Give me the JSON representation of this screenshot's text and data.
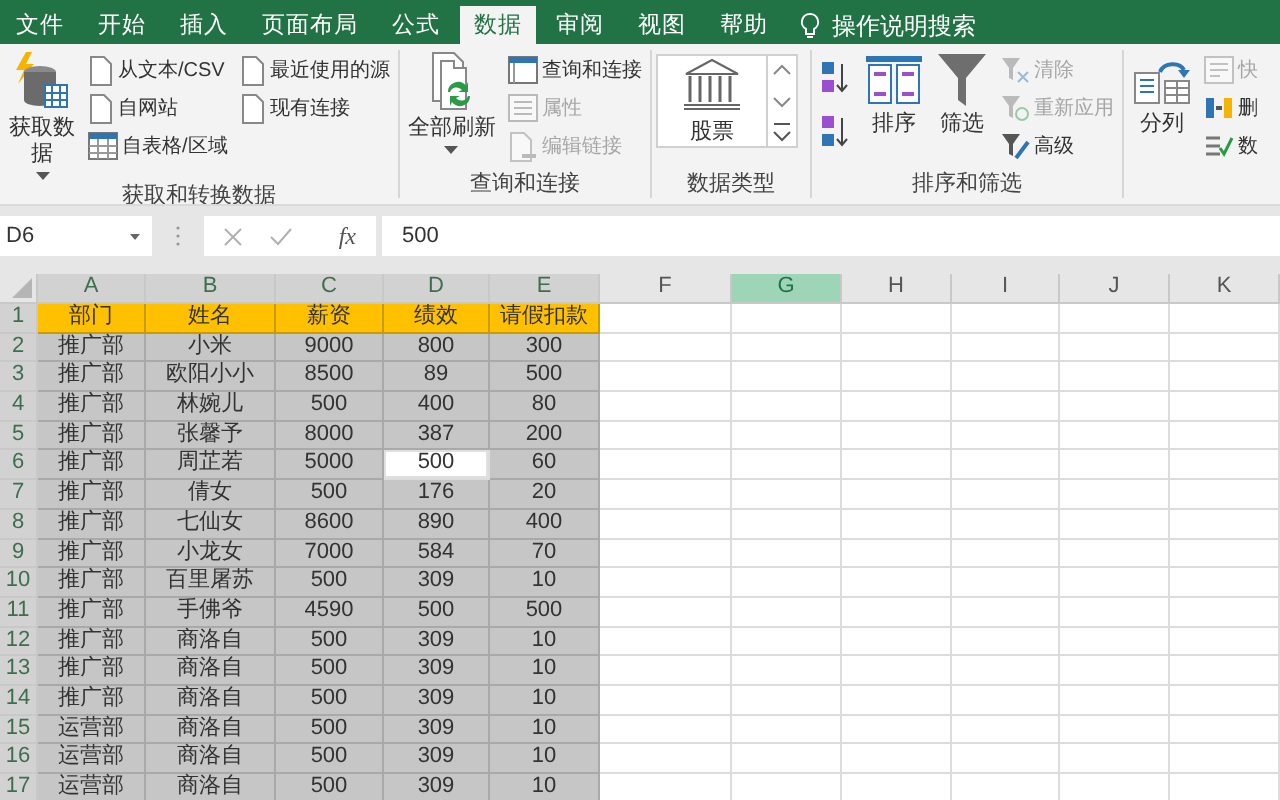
{
  "menu_tabs": [
    {
      "label": "文件",
      "selected": false
    },
    {
      "label": "开始",
      "selected": false
    },
    {
      "label": "插入",
      "selected": false
    },
    {
      "label": "页面布局",
      "selected": false
    },
    {
      "label": "公式",
      "selected": false
    },
    {
      "label": "数据",
      "selected": true
    },
    {
      "label": "审阅",
      "selected": false
    },
    {
      "label": "视图",
      "selected": false
    },
    {
      "label": "帮助",
      "selected": false
    }
  ],
  "tell_me": "操作说明搜索",
  "ribbon": {
    "groups": [
      {
        "label": "获取和转换数据",
        "items": [
          {
            "kind": "large",
            "label": "获取数据",
            "dropdown": true,
            "disabled": false
          },
          {
            "kind": "stack",
            "items": [
              {
                "label": "从文本/CSV",
                "disabled": false
              },
              {
                "label": "自网站",
                "disabled": false
              },
              {
                "label": "自表格/区域",
                "disabled": false
              }
            ]
          },
          {
            "kind": "stack",
            "items": [
              {
                "label": "最近使用的源",
                "disabled": false
              },
              {
                "label": "现有连接",
                "disabled": false
              }
            ]
          }
        ]
      },
      {
        "label": "查询和连接",
        "items": [
          {
            "kind": "large",
            "label": "全部刷新",
            "dropdown": true,
            "disabled": false
          },
          {
            "kind": "stack",
            "items": [
              {
                "label": "查询和连接",
                "disabled": false
              },
              {
                "label": "属性",
                "disabled": true
              },
              {
                "label": "编辑链接",
                "disabled": true
              }
            ]
          }
        ]
      },
      {
        "label": "数据类型",
        "items": [
          {
            "kind": "gallery",
            "label": "股票"
          }
        ]
      },
      {
        "label": "排序和筛选",
        "items": [
          {
            "kind": "stack",
            "items": [
              {
                "disabled": false
              },
              {
                "disabled": false
              }
            ]
          },
          {
            "kind": "large",
            "label": "排序",
            "dropdown": false,
            "disabled": false
          },
          {
            "kind": "large",
            "label": "筛选",
            "dropdown": false,
            "disabled": false
          },
          {
            "kind": "stack",
            "items": [
              {
                "label": "清除",
                "disabled": true
              },
              {
                "label": "重新应用",
                "disabled": true
              },
              {
                "label": "高级",
                "disabled": false
              }
            ]
          }
        ]
      },
      {
        "items": [
          {
            "kind": "large",
            "label": "分列",
            "dropdown": false,
            "disabled": false
          },
          {
            "kind": "stack",
            "items": [
              {
                "label": "快",
                "disabled": true
              },
              {
                "label": "删",
                "disabled": false
              },
              {
                "label": "数",
                "disabled": false
              }
            ]
          }
        ]
      }
    ]
  },
  "formula_bar": {
    "name_box": "D6",
    "fx": "fx",
    "value": "500"
  },
  "sheet": {
    "columns": [
      {
        "letter": "A",
        "selected": true,
        "hovered": false
      },
      {
        "letter": "B",
        "selected": true,
        "hovered": false
      },
      {
        "letter": "C",
        "selected": true,
        "hovered": false
      },
      {
        "letter": "D",
        "selected": true,
        "hovered": false
      },
      {
        "letter": "E",
        "selected": true,
        "hovered": false
      },
      {
        "letter": "F",
        "selected": false,
        "hovered": false
      },
      {
        "letter": "G",
        "selected": false,
        "hovered": true
      },
      {
        "letter": "H",
        "selected": false,
        "hovered": false
      },
      {
        "letter": "I",
        "selected": false,
        "hovered": false
      },
      {
        "letter": "J",
        "selected": false,
        "hovered": false
      },
      {
        "letter": "K",
        "selected": false,
        "hovered": false
      }
    ],
    "rows": [
      {
        "number": "1",
        "kind": "header",
        "selected": true,
        "cells": [
          {
            "text": "部门",
            "active": false
          },
          {
            "text": "姓名",
            "active": false
          },
          {
            "text": "薪资",
            "active": false
          },
          {
            "text": "绩效",
            "active": false
          },
          {
            "text": "请假扣款",
            "active": false
          }
        ]
      },
      {
        "number": "2",
        "kind": "data",
        "selected": true,
        "cells": [
          {
            "text": "推广部",
            "active": false
          },
          {
            "text": "小米",
            "active": false
          },
          {
            "text": "9000",
            "active": false
          },
          {
            "text": "800",
            "active": false
          },
          {
            "text": "300",
            "active": false
          }
        ]
      },
      {
        "number": "3",
        "kind": "data",
        "selected": true,
        "cells": [
          {
            "text": "推广部",
            "active": false
          },
          {
            "text": "欧阳小小",
            "active": false
          },
          {
            "text": "8500",
            "active": false
          },
          {
            "text": "89",
            "active": false
          },
          {
            "text": "500",
            "active": false
          }
        ]
      },
      {
        "number": "4",
        "kind": "data",
        "selected": true,
        "cells": [
          {
            "text": "推广部",
            "active": false
          },
          {
            "text": "林婉儿",
            "active": false
          },
          {
            "text": "500",
            "active": false
          },
          {
            "text": "400",
            "active": false
          },
          {
            "text": "80",
            "active": false
          }
        ]
      },
      {
        "number": "5",
        "kind": "data",
        "selected": true,
        "cells": [
          {
            "text": "推广部",
            "active": false
          },
          {
            "text": "张馨予",
            "active": false
          },
          {
            "text": "8000",
            "active": false
          },
          {
            "text": "387",
            "active": false
          },
          {
            "text": "200",
            "active": false
          }
        ]
      },
      {
        "number": "6",
        "kind": "data",
        "selected": true,
        "cells": [
          {
            "text": "推广部",
            "active": false
          },
          {
            "text": "周芷若",
            "active": false
          },
          {
            "text": "5000",
            "active": false
          },
          {
            "text": "500",
            "active": true
          },
          {
            "text": "60",
            "active": false
          }
        ]
      },
      {
        "number": "7",
        "kind": "data",
        "selected": true,
        "cells": [
          {
            "text": "推广部",
            "active": false
          },
          {
            "text": "倩女",
            "active": false
          },
          {
            "text": "500",
            "active": false
          },
          {
            "text": "176",
            "active": false
          },
          {
            "text": "20",
            "active": false
          }
        ]
      },
      {
        "number": "8",
        "kind": "data",
        "selected": true,
        "cells": [
          {
            "text": "推广部",
            "active": false
          },
          {
            "text": "七仙女",
            "active": false
          },
          {
            "text": "8600",
            "active": false
          },
          {
            "text": "890",
            "active": false
          },
          {
            "text": "400",
            "active": false
          }
        ]
      },
      {
        "number": "9",
        "kind": "data",
        "selected": true,
        "cells": [
          {
            "text": "推广部",
            "active": false
          },
          {
            "text": "小龙女",
            "active": false
          },
          {
            "text": "7000",
            "active": false
          },
          {
            "text": "584",
            "active": false
          },
          {
            "text": "70",
            "active": false
          }
        ]
      },
      {
        "number": "10",
        "kind": "data",
        "selected": true,
        "cells": [
          {
            "text": "推广部",
            "active": false
          },
          {
            "text": "百里屠苏",
            "active": false
          },
          {
            "text": "500",
            "active": false
          },
          {
            "text": "309",
            "active": false
          },
          {
            "text": "10",
            "active": false
          }
        ]
      },
      {
        "number": "11",
        "kind": "data",
        "selected": true,
        "cells": [
          {
            "text": "推广部",
            "active": false
          },
          {
            "text": "手佛爷",
            "active": false
          },
          {
            "text": "4590",
            "active": false
          },
          {
            "text": "500",
            "active": false
          },
          {
            "text": "500",
            "active": false
          }
        ]
      },
      {
        "number": "12",
        "kind": "data",
        "selected": true,
        "cells": [
          {
            "text": "推广部",
            "active": false
          },
          {
            "text": "商洛自",
            "active": false
          },
          {
            "text": "500",
            "active": false
          },
          {
            "text": "309",
            "active": false
          },
          {
            "text": "10",
            "active": false
          }
        ]
      },
      {
        "number": "13",
        "kind": "data",
        "selected": true,
        "cells": [
          {
            "text": "推广部",
            "active": false
          },
          {
            "text": "商洛自",
            "active": false
          },
          {
            "text": "500",
            "active": false
          },
          {
            "text": "309",
            "active": false
          },
          {
            "text": "10",
            "active": false
          }
        ]
      },
      {
        "number": "14",
        "kind": "data",
        "selected": true,
        "cells": [
          {
            "text": "推广部",
            "active": false
          },
          {
            "text": "商洛自",
            "active": false
          },
          {
            "text": "500",
            "active": false
          },
          {
            "text": "309",
            "active": false
          },
          {
            "text": "10",
            "active": false
          }
        ]
      },
      {
        "number": "15",
        "kind": "data",
        "selected": true,
        "cells": [
          {
            "text": "运营部",
            "active": false
          },
          {
            "text": "商洛自",
            "active": false
          },
          {
            "text": "500",
            "active": false
          },
          {
            "text": "309",
            "active": false
          },
          {
            "text": "10",
            "active": false
          }
        ]
      },
      {
        "number": "16",
        "kind": "data",
        "selected": true,
        "cells": [
          {
            "text": "运营部",
            "active": false
          },
          {
            "text": "商洛自",
            "active": false
          },
          {
            "text": "500",
            "active": false
          },
          {
            "text": "309",
            "active": false
          },
          {
            "text": "10",
            "active": false
          }
        ]
      },
      {
        "number": "17",
        "kind": "data",
        "selected": true,
        "cells": [
          {
            "text": "运营部",
            "active": false
          },
          {
            "text": "商洛自",
            "active": false
          },
          {
            "text": "500",
            "active": false
          },
          {
            "text": "309",
            "active": false
          },
          {
            "text": "10",
            "active": false
          }
        ]
      }
    ]
  }
}
